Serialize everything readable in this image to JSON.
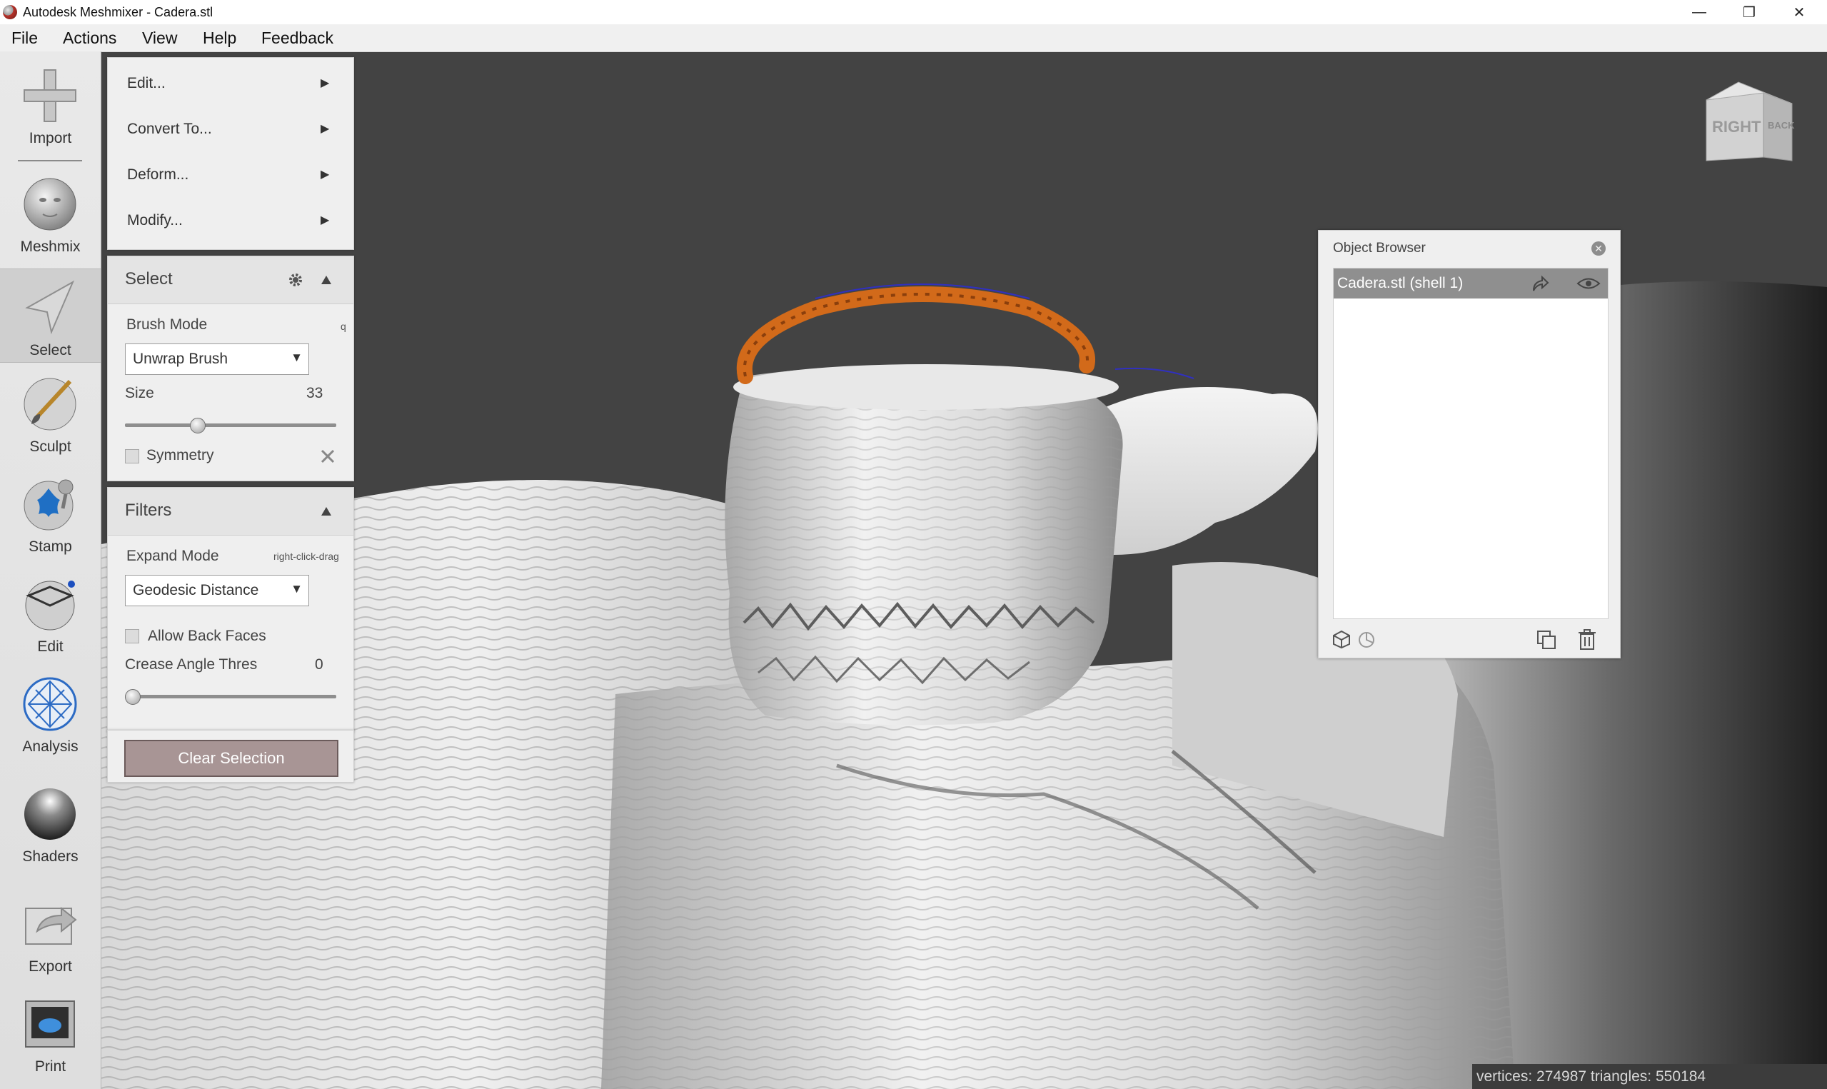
{
  "window": {
    "title": "Autodesk Meshmixer - Cadera.stl",
    "controls": {
      "minimize": "—",
      "restore": "❐",
      "close": "✕"
    }
  },
  "menubar": {
    "items": [
      "File",
      "Actions",
      "View",
      "Help",
      "Feedback"
    ]
  },
  "toolbar": {
    "tools": [
      {
        "label": "Import",
        "icon": "plus-icon"
      },
      {
        "label": "Meshmix",
        "icon": "meshmix-head-icon"
      },
      {
        "label": "Select",
        "icon": "select-arrow-icon",
        "active": true
      },
      {
        "label": "Sculpt",
        "icon": "sculpt-brush-icon"
      },
      {
        "label": "Stamp",
        "icon": "stamp-icon"
      },
      {
        "label": "Edit",
        "icon": "edit-mesh-icon"
      },
      {
        "label": "Analysis",
        "icon": "analysis-icon"
      },
      {
        "label": "Shaders",
        "icon": "shader-sphere-icon"
      },
      {
        "label": "Export",
        "icon": "export-icon"
      },
      {
        "label": "Print",
        "icon": "printer-icon"
      }
    ]
  },
  "select_menu": {
    "items": [
      "Edit...",
      "Convert To...",
      "Deform...",
      "Modify..."
    ],
    "arrow": "▶"
  },
  "select_panel": {
    "title": "Select",
    "brush_mode_label": "Brush Mode",
    "brush_mode_hotkey": "q",
    "brush_mode_value": "Unwrap Brush",
    "size_label": "Size",
    "size_value": "33",
    "size_fraction": 0.33,
    "symmetry_label": "Symmetry",
    "symmetry_checked": false
  },
  "filters_panel": {
    "title": "Filters",
    "expand_mode_label": "Expand Mode",
    "expand_mode_hint": "right-click-drag",
    "expand_mode_value": "Geodesic Distance",
    "allow_back_faces_label": "Allow Back Faces",
    "allow_back_faces_checked": false,
    "crease_angle_label": "Crease Angle Thres",
    "crease_angle_value": "0",
    "crease_fraction": 0
  },
  "clear_selection_label": "Clear Selection",
  "view_cube": {
    "face_front": "RIGHT",
    "face_side": "BACK"
  },
  "object_browser": {
    "title": "Object Browser",
    "items": [
      {
        "label": "Cadera.stl (shell 1)",
        "selected": true,
        "visible": true
      }
    ]
  },
  "status": {
    "text": "vertices: 274987 triangles: 550184"
  },
  "colors": {
    "selection_orange": "#d26a1a",
    "viewport_bg": "#434343",
    "selected_row": "#8f8f8f"
  }
}
